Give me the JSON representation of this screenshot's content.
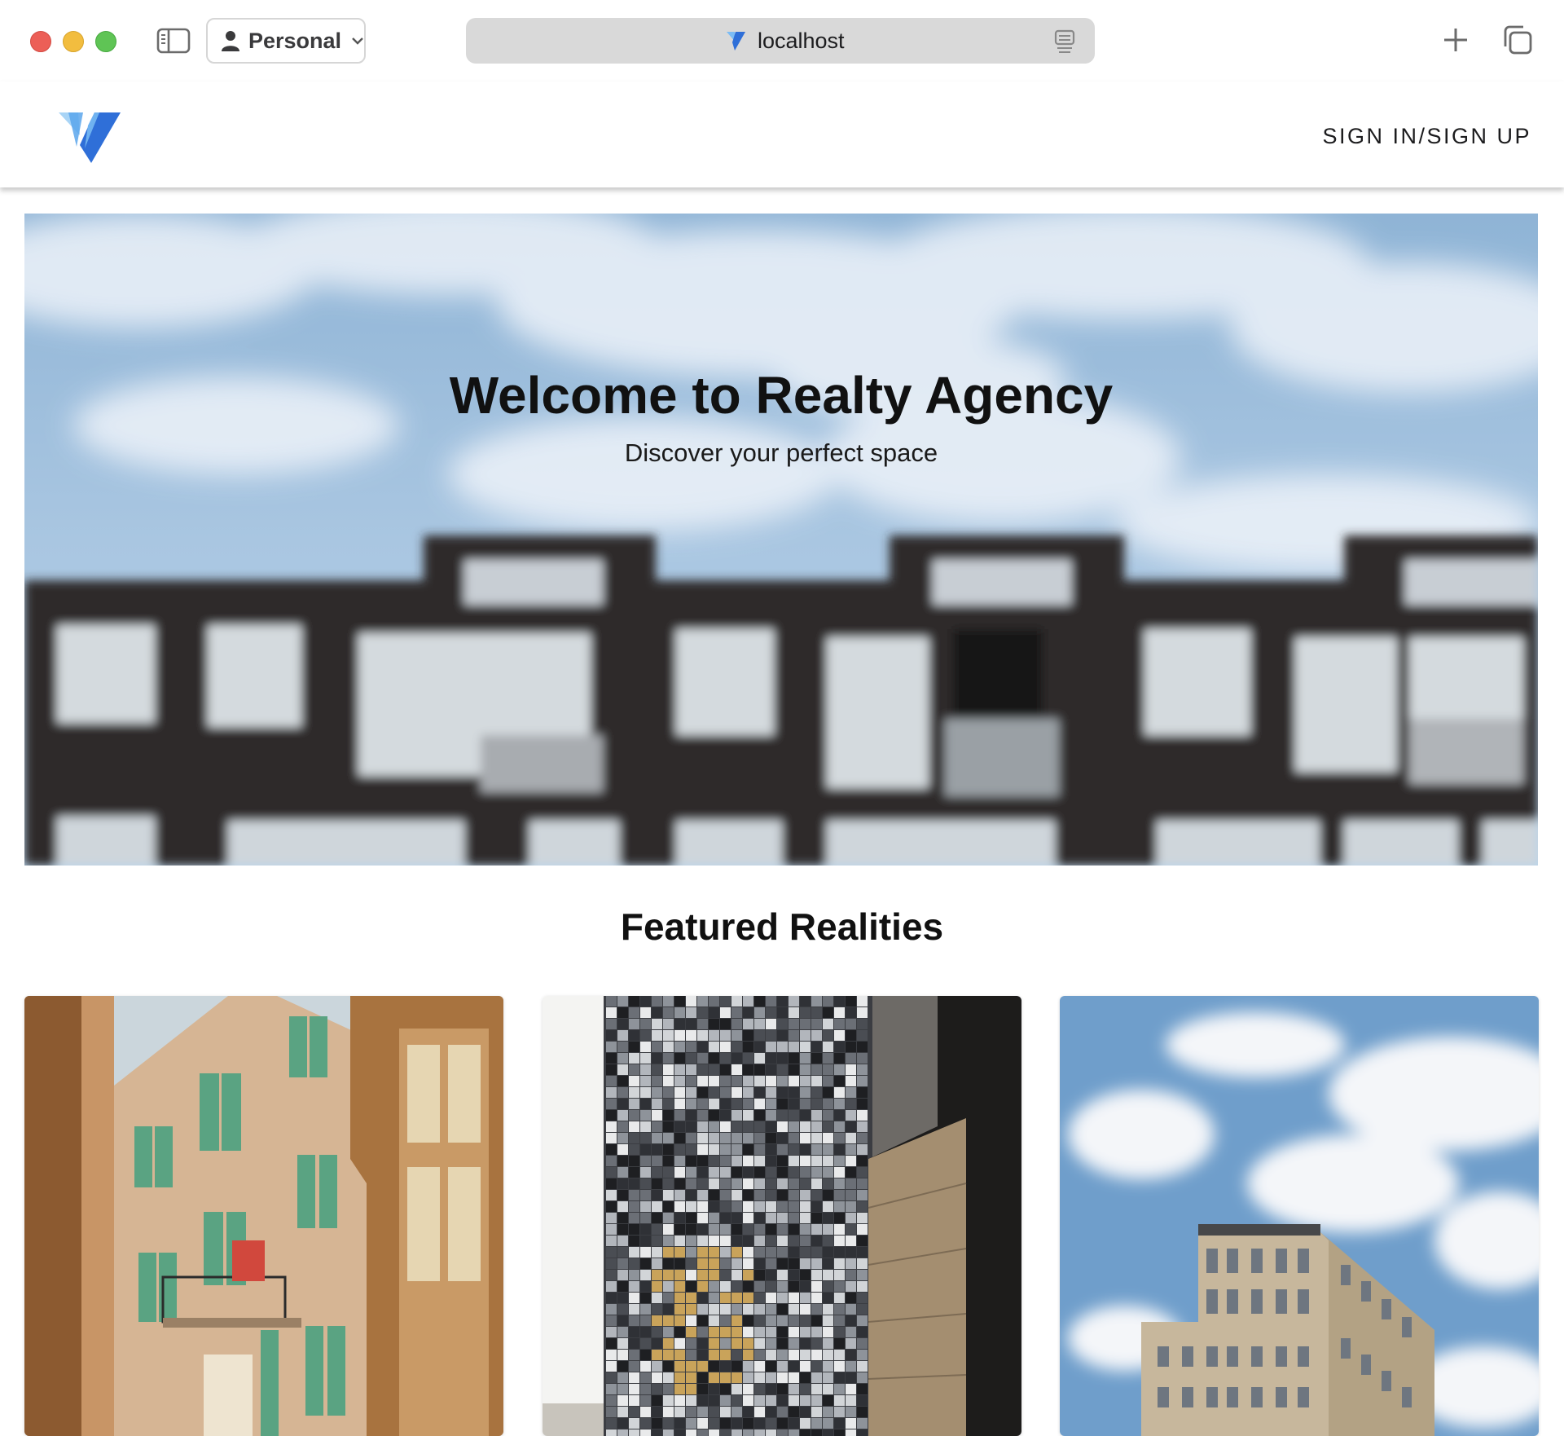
{
  "browser": {
    "profile_label": "Personal",
    "url": "localhost",
    "icons": [
      "sidebar-icon",
      "person-icon",
      "chevron-down-icon",
      "favicon-icon",
      "reader-icon",
      "plus-icon",
      "tabs-overview-icon"
    ]
  },
  "header": {
    "nav_signin": "SIGN IN/SIGN UP",
    "logo": "realty-logo-icon"
  },
  "hero": {
    "title": "Welcome to Realty Agency",
    "subtitle": "Discover your perfect space"
  },
  "featured": {
    "title": "Featured Realities",
    "cards": [
      {
        "image": "old-apartment-building-photo"
      },
      {
        "image": "mosaic-tower-photo"
      },
      {
        "image": "tower-under-clouds-photo"
      }
    ]
  },
  "colors": {
    "brand_blue": "#2f6fd8",
    "brand_light_blue": "#6fb2f0",
    "text_dark": "#111111",
    "shutter_green": "#5aa382"
  }
}
